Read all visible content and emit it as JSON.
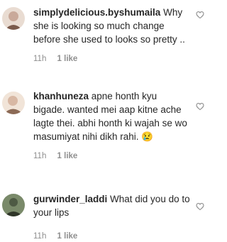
{
  "comments": [
    {
      "username": "simplydelicious.byshumaila",
      "text": "Why she is looking so much change before she used to looks so pretty ..",
      "time": "11h",
      "likes": "1 like",
      "avatar_colors": [
        "#e9dcd2",
        "#c9a99a",
        "#7a5a4c"
      ],
      "liked": false
    },
    {
      "username": "khanhuneza",
      "text": "apne honth kyu bigade. wanted mei aap kitne ache lagte thei. abhi honth ki wajah se wo masumiyat nihi dikh rahi.",
      "emoji": "😢",
      "time": "11h",
      "likes": "1 like",
      "avatar_colors": [
        "#f1e4d8",
        "#d8b8a4",
        "#8c6a56"
      ],
      "liked": false
    },
    {
      "username": "gurwinder_laddi",
      "text": "What did you do to your lips",
      "time": "11h",
      "likes": "1 like",
      "avatar_colors": [
        "#7a8a6a",
        "#4e5a44",
        "#2f3628"
      ],
      "liked": false
    }
  ],
  "colors": {
    "text": "#262626",
    "muted": "#8e8e8e",
    "heart_stroke": "#8e8e8e"
  },
  "icons": {
    "heart": "heart-outline-icon",
    "emoji": "crying-face-emoji"
  }
}
